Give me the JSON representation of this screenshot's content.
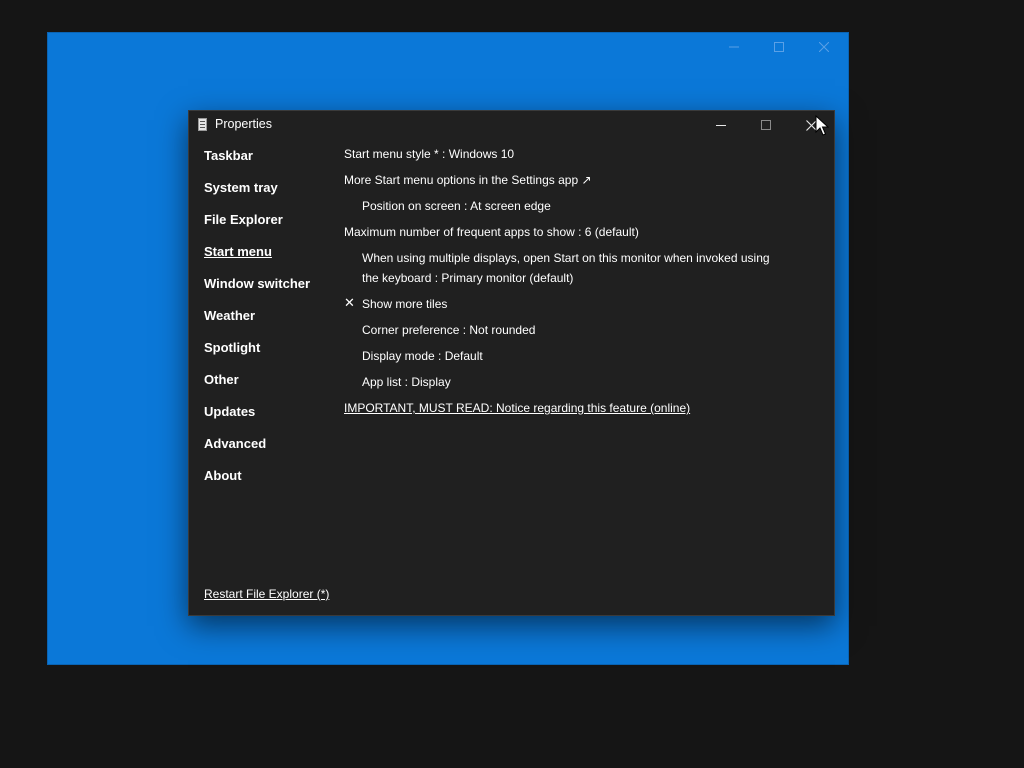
{
  "background_window": {
    "color": "#0b78d8"
  },
  "dialog": {
    "title": "Properties",
    "nav": [
      {
        "label": "Taskbar"
      },
      {
        "label": "System tray"
      },
      {
        "label": "File Explorer"
      },
      {
        "label": "Start menu",
        "active": true
      },
      {
        "label": "Window switcher"
      },
      {
        "label": "Weather"
      },
      {
        "label": "Spotlight"
      },
      {
        "label": "Other"
      },
      {
        "label": "Updates"
      },
      {
        "label": "Advanced"
      },
      {
        "label": "About"
      }
    ],
    "settings": {
      "start_menu_style": "Start menu style * : Windows 10",
      "more_options_link": "More Start menu options in the Settings app ↗",
      "position_on_screen": "Position on screen : At screen edge",
      "max_frequent_apps": "Maximum number of frequent apps to show : 6 (default)",
      "multi_display": "When using multiple displays, open Start on this monitor when invoked using the keyboard : Primary monitor (default)",
      "show_more_tiles_mark": "✕",
      "show_more_tiles": "Show more tiles",
      "corner_preference": "Corner preference : Not rounded",
      "display_mode": "Display mode : Default",
      "app_list": "App list : Display",
      "important_link": "IMPORTANT, MUST READ: Notice regarding this feature (online)"
    },
    "footer_link": "Restart File Explorer (*)"
  },
  "icons": {
    "app": "file-icon",
    "minimize": "minimize-icon",
    "maximize": "maximize-icon",
    "close": "close-icon",
    "cursor": "mouse-cursor-icon"
  }
}
